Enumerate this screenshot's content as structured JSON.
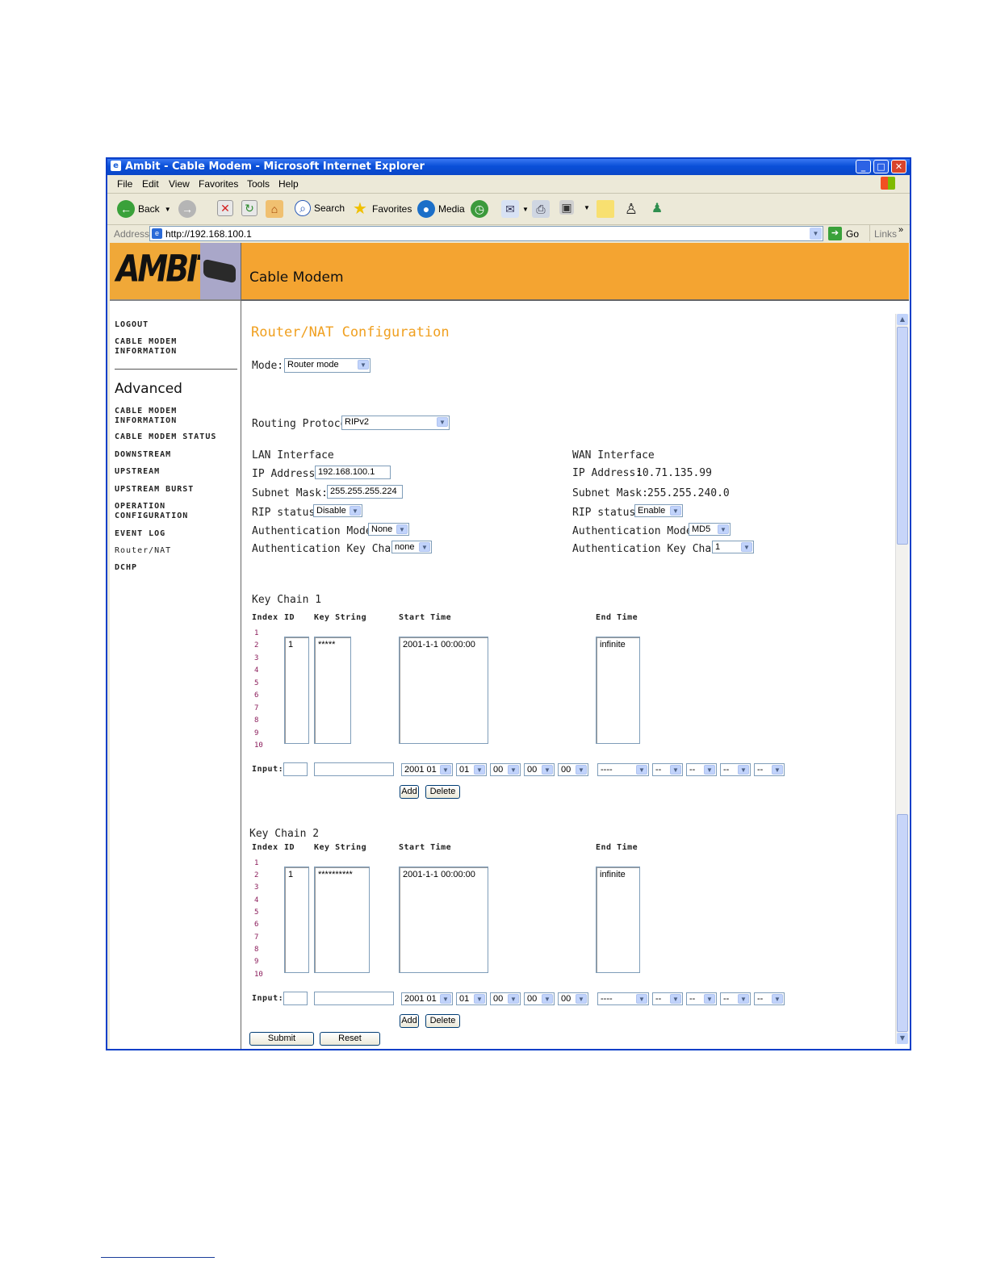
{
  "window": {
    "title": "Ambit - Cable Modem - Microsoft Internet Explorer",
    "min": "_",
    "max": "□",
    "close": "✕"
  },
  "menu": [
    "File",
    "Edit",
    "View",
    "Favorites",
    "Tools",
    "Help"
  ],
  "toolbar": {
    "back": "Back",
    "search": "Search",
    "favorites": "Favorites",
    "media": "Media"
  },
  "address": {
    "label": "Address",
    "url": "http://192.168.100.1",
    "go": "Go",
    "links": "Links"
  },
  "header": {
    "logo": "AMBIT",
    "title": "Cable Modem"
  },
  "sidebar": {
    "top_items": [
      "LOGOUT",
      "CABLE MODEM INFORMATION"
    ],
    "section": "Advanced",
    "items": [
      "CABLE MODEM INFORMATION",
      "CABLE MODEM STATUS",
      "DOWNSTREAM",
      "UPSTREAM",
      "UPSTREAM BURST",
      "OPERATION CONFIGURATION",
      "EVENT LOG",
      "Router/NAT",
      "DCHP"
    ]
  },
  "content": {
    "heading": "Router/NAT Configuration",
    "mode_label": "Mode:",
    "mode_value": "Router mode",
    "routing_label": "Routing Protocol:",
    "routing_value": "RIPv2",
    "lan": {
      "title": "LAN Interface",
      "ip_label": "IP Address:",
      "ip_value": "192.168.100.1",
      "mask_label": "Subnet Mask:",
      "mask_value": "255.255.255.224",
      "rip_label": "RIP status:",
      "rip_value": "Disable",
      "auth_label": "Authentication Mode:",
      "auth_value": "None",
      "keychain_label": "Authentication Key Chain:",
      "keychain_value": "none"
    },
    "wan": {
      "title": "WAN Interface",
      "ip_label": "IP Address:",
      "ip_value": "10.71.135.99",
      "mask_label": "Subnet Mask:",
      "mask_value": "255.255.240.0",
      "rip_label": "RIP status:",
      "rip_value": "Enable",
      "auth_label": "Authentication Mode:",
      "auth_value": "MD5",
      "keychain_label": "Authentication Key Chain:",
      "keychain_value": "1"
    },
    "columns": {
      "index": "Index",
      "id": "ID",
      "key": "Key String",
      "start": "Start Time",
      "end": "End Time"
    },
    "indices": [
      "1",
      "2",
      "3",
      "4",
      "5",
      "6",
      "7",
      "8",
      "9",
      "10"
    ],
    "input_label": "Input:",
    "add": "Add",
    "delete": "Delete",
    "kc1": {
      "title": "Key Chain 1",
      "id": "1",
      "key": "*****",
      "start": "2001-1-1 00:00:00",
      "end": "infinite",
      "in_year": "2001",
      "in_mon": "01",
      "in_day": "01",
      "in_h": "00",
      "in_m": "00",
      "in_s": "00",
      "in_e1": "----",
      "in_e2": "--",
      "in_e3": "--",
      "in_e4": "--",
      "in_e5": "--"
    },
    "kc2": {
      "title": "Key Chain 2",
      "id": "1",
      "key": "**********",
      "start": "2001-1-1 00:00:00",
      "end": "infinite",
      "in_year": "2001",
      "in_mon": "01",
      "in_day": "01",
      "in_h": "00",
      "in_m": "00",
      "in_s": "00",
      "in_e1": "----",
      "in_e2": "--",
      "in_e3": "--",
      "in_e4": "--",
      "in_e5": "--"
    },
    "submit": "Submit",
    "reset": "Reset"
  }
}
